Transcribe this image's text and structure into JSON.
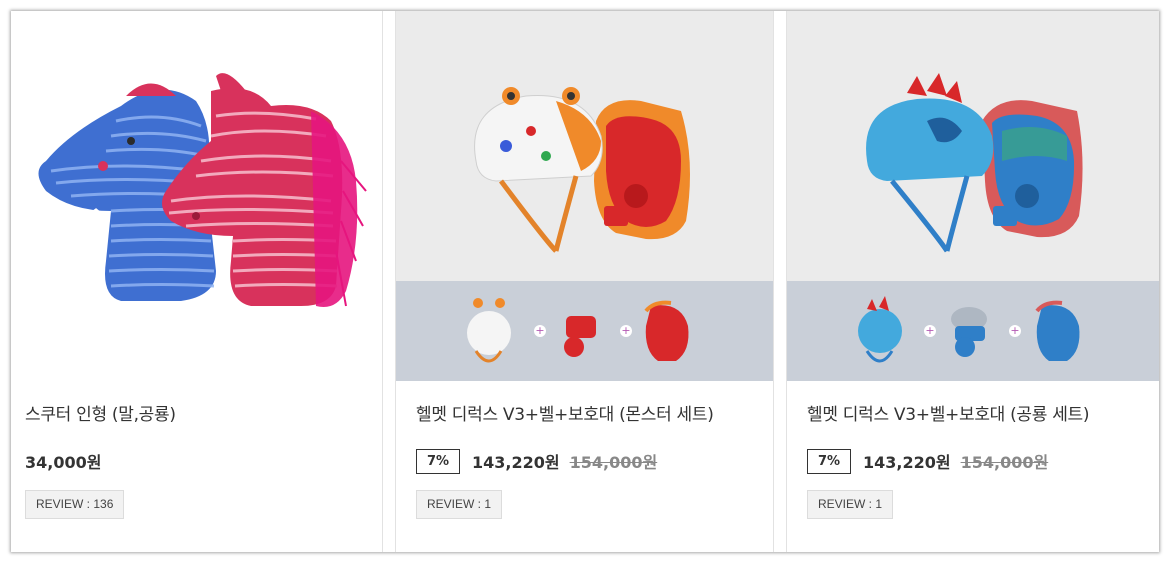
{
  "products": [
    {
      "name": "스쿠터 인형 (말,공룡)",
      "price": "34,000원",
      "review": "REVIEW : 136",
      "image": "plush-dragon-horse-image"
    },
    {
      "name": "헬멧 디럭스 V3+벨+보호대 (몬스터 세트)",
      "discount": "7%",
      "price": "143,220원",
      "original_price": "154,000원",
      "review": "REVIEW : 1",
      "image": "monster-helmet-set-image",
      "set_plus": [
        "+",
        "+"
      ]
    },
    {
      "name": "헬멧 디럭스 V3+벨+보호대 (공룡 세트)",
      "discount": "7%",
      "price": "143,220원",
      "original_price": "154,000원",
      "review": "REVIEW : 1",
      "image": "dino-helmet-set-image",
      "set_plus": [
        "+",
        "+"
      ]
    }
  ],
  "colors": {
    "strip": "#c9cfd8",
    "thumb_bg": "#ebebeb",
    "blue_plush": "#3f6fd1",
    "pink_plush": "#d8325c",
    "helmet_red": "#d8282a",
    "helmet_blue": "#43a9dd"
  }
}
